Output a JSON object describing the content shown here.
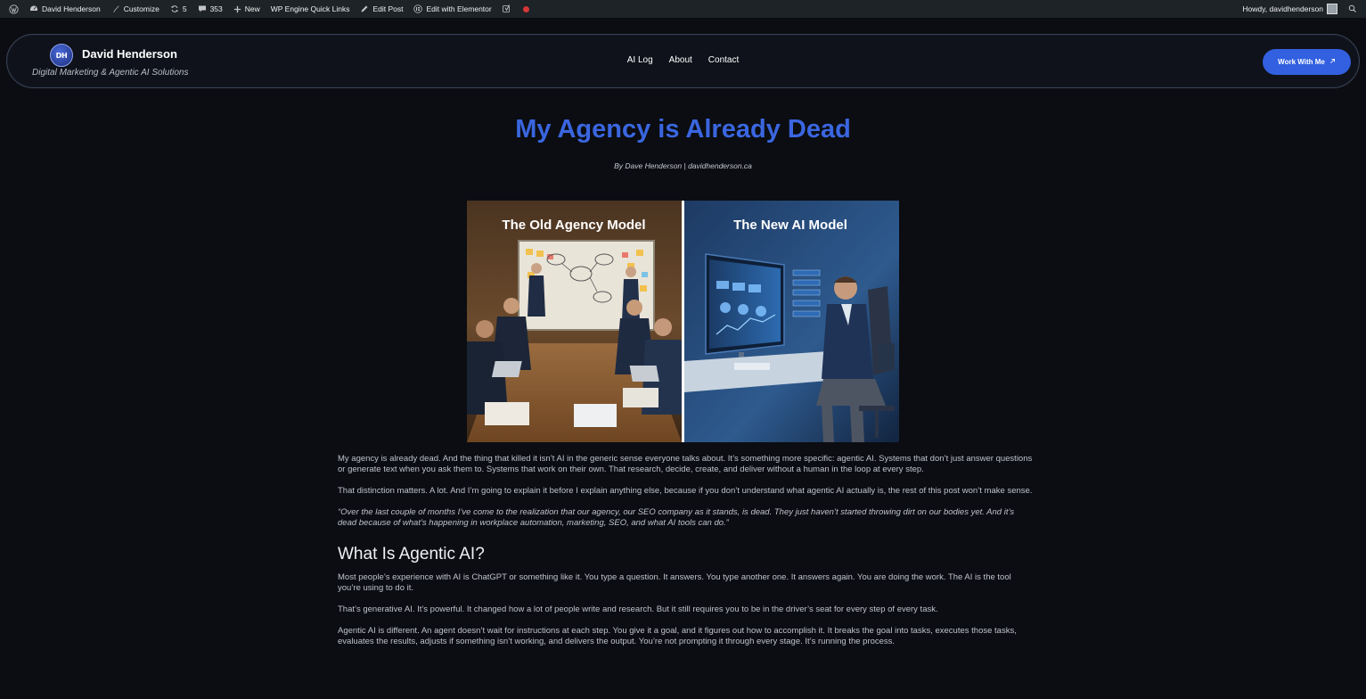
{
  "admin_bar": {
    "site_name": "David Henderson",
    "customize": "Customize",
    "updates_count": "5",
    "comments_count": "353",
    "new_label": "New",
    "quick_links": "WP Engine Quick Links",
    "edit_post": "Edit Post",
    "edit_elementor": "Edit with Elementor",
    "greeting": "Howdy, davidhenderson"
  },
  "header": {
    "logo_initials": "DH",
    "site_title": "David Henderson",
    "tagline": "Digital Marketing & Agentic AI Solutions",
    "nav": [
      {
        "label": "AI Log"
      },
      {
        "label": "About"
      },
      {
        "label": "Contact"
      }
    ],
    "cta_label": "Work With Me",
    "accent": "#3260e0"
  },
  "post": {
    "title": "My Agency is Already Dead",
    "byline": "By Dave Henderson | davidhenderson.ca",
    "hero": {
      "left_caption": "The Old Agency Model",
      "right_caption": "The New AI Model"
    },
    "paragraphs": [
      "My agency is already dead. And the thing that killed it isn’t AI in the generic sense everyone talks about. It’s something more specific: agentic AI. Systems that don’t just answer questions or generate text when you ask them to. Systems that work on their own. That research, decide, create, and deliver without a human in the loop at every step.",
      "That distinction matters. A lot. And I’m going to explain it before I explain anything else, because if you don’t understand what agentic AI actually is, the rest of this post won’t make sense."
    ],
    "quote": "“Over the last couple of months I’ve come to the realization that our agency, our SEO company as it stands, is dead. They just haven’t started throwing dirt on our bodies yet. And it’s dead because of what’s happening in workplace automation, marketing, SEO, and what AI tools can do.”",
    "heading": "What Is Agentic AI?",
    "section_paragraphs": [
      "Most people’s experience with AI is ChatGPT or something like it. You type a question. It answers. You type another one. It answers again. You are doing the work. The AI is the tool you’re using to do it.",
      "That’s generative AI. It’s powerful. It changed how a lot of people write and research. But it still requires you to be in the driver’s seat for every step of every task.",
      "Agentic AI is different. An agent doesn’t wait for instructions at each step. You give it a goal, and it figures out how to accomplish it. It breaks the goal into tasks, executes those tasks, evaluates the results, adjusts if something isn’t working, and delivers the output. You’re not prompting it through every stage. It’s running the process."
    ]
  }
}
